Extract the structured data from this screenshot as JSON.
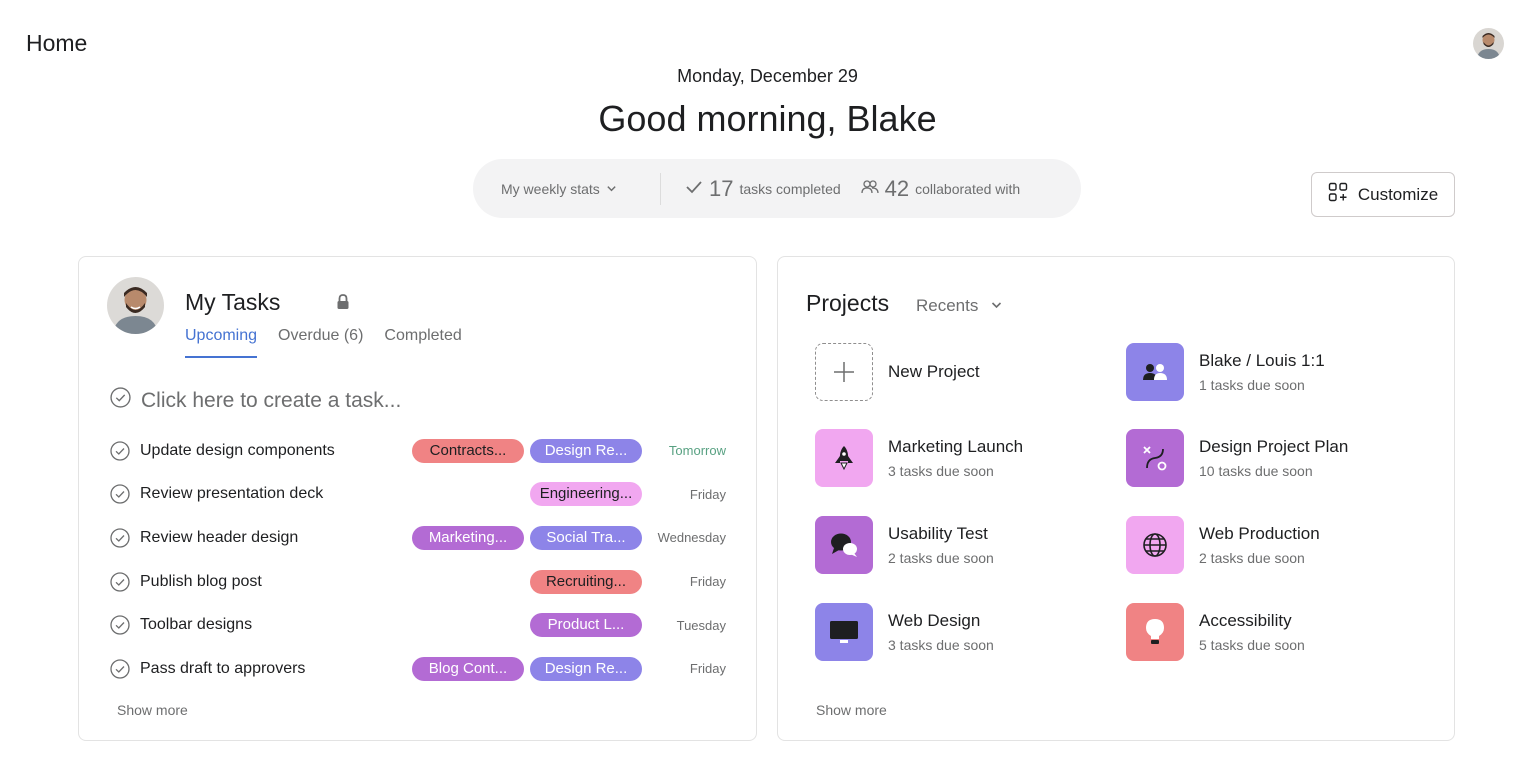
{
  "header": {
    "title": "Home"
  },
  "welcome": {
    "date": "Monday, December 29",
    "greeting": "Good morning, Blake"
  },
  "stats": {
    "dropdown_label": "My weekly stats",
    "tasks_completed_count": "17",
    "tasks_completed_label": "tasks completed",
    "collaborated_count": "42",
    "collaborated_label": "collaborated with"
  },
  "customize_label": "Customize",
  "my_tasks": {
    "title": "My Tasks",
    "tabs": [
      "Upcoming",
      "Overdue (6)",
      "Completed"
    ],
    "active_tab": "Upcoming",
    "create_placeholder": "Click here to create a task...",
    "tasks": [
      {
        "name": "Update design components",
        "tags": [
          {
            "label": "Contracts...",
            "color": "#f08384"
          },
          {
            "label": "Design Re...",
            "color": "#8d84e8"
          }
        ],
        "due": "Tomorrow"
      },
      {
        "name": "Review presentation deck",
        "tags": [
          {
            "label": "Engineering...",
            "color": "#f1a7f0"
          }
        ],
        "due": "Friday"
      },
      {
        "name": "Review header design",
        "tags": [
          {
            "label": "Marketing...",
            "color": "#b36bd4"
          },
          {
            "label": "Social Tra...",
            "color": "#8d84e8"
          }
        ],
        "due": "Wednesday"
      },
      {
        "name": "Publish blog post",
        "tags": [
          {
            "label": "Recruiting...",
            "color": "#f08384"
          }
        ],
        "due": "Friday"
      },
      {
        "name": "Toolbar designs",
        "tags": [
          {
            "label": "Product L...",
            "color": "#b36bd4"
          }
        ],
        "due": "Tuesday"
      },
      {
        "name": "Pass draft to approvers",
        "tags": [
          {
            "label": "Blog Cont...",
            "color": "#b36bd4"
          },
          {
            "label": "Design Re...",
            "color": "#8d84e8"
          }
        ],
        "due": "Friday"
      }
    ],
    "show_more": "Show more"
  },
  "projects": {
    "title": "Projects",
    "filter": "Recents",
    "items": [
      {
        "name": "New Project",
        "subtitle": "",
        "icon": "plus-icon",
        "color": "#ffffff"
      },
      {
        "name": "Blake / Louis 1:1",
        "subtitle": "1 tasks due soon",
        "icon": "people-icon",
        "color": "#8d84e8"
      },
      {
        "name": "Marketing Launch",
        "subtitle": "3 tasks due soon",
        "icon": "rocket-icon",
        "color": "#f1a7f0"
      },
      {
        "name": "Design Project Plan",
        "subtitle": "10 tasks due soon",
        "icon": "route-icon",
        "color": "#b36bd4"
      },
      {
        "name": "Usability Test",
        "subtitle": "2 tasks due soon",
        "icon": "chat-bubbles-icon",
        "color": "#b36bd4"
      },
      {
        "name": "Web Production",
        "subtitle": "2 tasks due soon",
        "icon": "globe-icon",
        "color": "#f1a7f0"
      },
      {
        "name": "Web Design",
        "subtitle": "3 tasks due soon",
        "icon": "monitor-icon",
        "color": "#8d84e8"
      },
      {
        "name": "Accessibility",
        "subtitle": "5 tasks due soon",
        "icon": "lightbulb-icon",
        "color": "#f08384"
      }
    ],
    "show_more": "Show more"
  }
}
